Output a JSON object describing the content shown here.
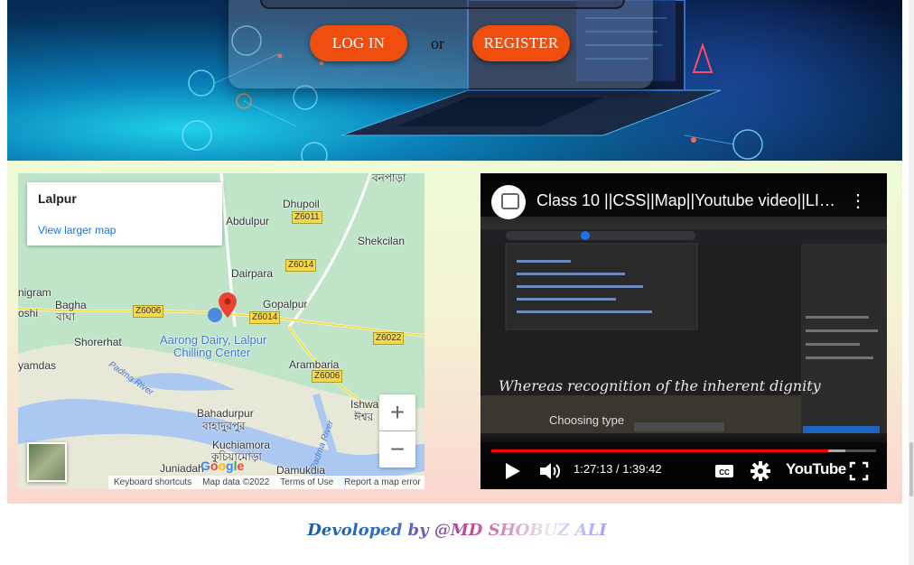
{
  "hero": {
    "login_label": "LOG IN",
    "or_label": "or",
    "register_label": "REGISTER"
  },
  "map": {
    "card_title": "Lalpur",
    "card_link": "View larger map",
    "places": {
      "banpara_bn": "বনপাড়া",
      "dhupoil": "Dhupoil",
      "abdulpur": "Abdulpur",
      "shekcilan": "Shekcilan",
      "dairpara": "Dairpara",
      "nigram": "nigram",
      "bagha": "Bagha",
      "bagha_bn": "বাঘা",
      "oshi": "oshi",
      "gopalpur": "Gopalpur",
      "shorerhat": "Shorerhat",
      "arambaria": "Arambaria",
      "yamdas": "yamdas",
      "bahadurpur": "Bahadurpur",
      "bahadurpur_bn": "বাহাদুরপুর",
      "ishwa": "Ishwa",
      "ishwa_bn": "ঈশ্বর",
      "kuchiamora": "Kuchiamora",
      "kuchiamora_bn": "কুচিয়ামোড়া",
      "juniadah": "Juniadah",
      "damukdia": "Damukdia",
      "aarong_line1": "Aarong Dairy, Lalpur",
      "aarong_line2": "Chilling Center"
    },
    "roads": [
      "Z6011",
      "Z6014",
      "Z6006",
      "Z6014",
      "Z6022",
      "Z6006"
    ],
    "rivers": [
      "Padma River",
      "Padma River"
    ],
    "zoom_in": "+",
    "zoom_out": "−",
    "google_logo": "Google",
    "footer": {
      "shortcuts": "Keyboard shortcuts",
      "data": "Map data ©2022",
      "terms": "Terms of Use",
      "report": "Report a map error"
    }
  },
  "video": {
    "title": "Class 10 ||CSS||Map||Youtube video||LITE…",
    "cursive_text": "Whereas recognition of the inherent dignity",
    "choosing_text": "Choosing type",
    "time": "1:27:13 / 1:39:42",
    "progress": 0.875,
    "buffered": 0.92,
    "youtube_label": "YouTube"
  },
  "footer": {
    "credit": "Devoloped by @MD SHOBUZ ALI"
  },
  "colors": {
    "accent": "#f04e0e",
    "yt_red": "#ff0000",
    "map_link": "#1a73e8"
  }
}
